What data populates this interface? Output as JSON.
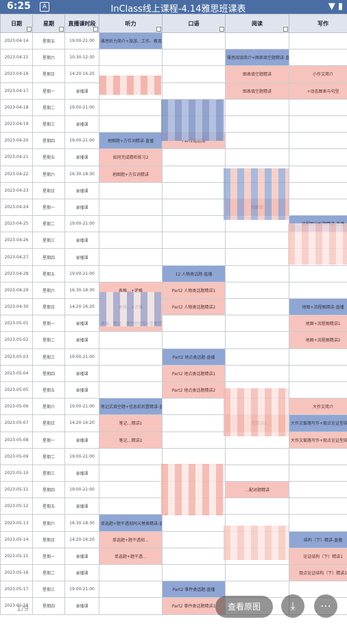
{
  "status_bar": {
    "time": "6:25",
    "app_badge": "A",
    "title": "InClass线上课程-4.14雅思班课表",
    "icons": "▼ ▮"
  },
  "headers": {
    "date": "日期",
    "weekday": "星期",
    "time": "直播课时段",
    "listening": "听力",
    "speaking": "口语",
    "reading": "阅读",
    "writing": "写作"
  },
  "rows": [
    {
      "date": "2023-04-14",
      "week": "星期五",
      "time": "19:00-21:00",
      "l": "雅思听力简介+旅游、工作、教育相关场景词-直播",
      "s": "",
      "r": "",
      "w": ""
    },
    {
      "date": "2023-04-15",
      "week": "星期六",
      "time": "10:30-12:30",
      "l": "",
      "s": "",
      "r": "雅思阅读简介+图表填空题精讲-直播",
      "w": ""
    },
    {
      "date": "2023-04-16",
      "week": "星期日",
      "time": "14:20-16:20",
      "l": "",
      "s": "",
      "r": "图表填空题精讲",
      "w": "小作文简介"
    },
    {
      "date": "2023-04-17",
      "week": "星期一",
      "time": "录播课",
      "l": "",
      "s": "",
      "r": "图表填空题精讲",
      "w": "+动态图表与句型"
    },
    {
      "date": "2023-04-18",
      "week": "星期二",
      "time": "19:00-21:00",
      "l": "",
      "s": "",
      "r": "",
      "w": ""
    },
    {
      "date": "2023-04-19",
      "week": "星期三",
      "time": "录播课",
      "l": "",
      "s": "",
      "r": "",
      "w": ""
    },
    {
      "date": "2023-04-20",
      "week": "星期四",
      "time": "19:00-21:00",
      "l": "地图题+方位词精讲-直播",
      "s": "Part1话题精",
      "r": "",
      "w": ""
    },
    {
      "date": "2023-04-21",
      "week": "星期五",
      "time": "录播课",
      "l": "如何完成精听练习2",
      "s": "",
      "r": "",
      "w": ""
    },
    {
      "date": "2023-04-22",
      "week": "星期六",
      "time": "16:30-18:30",
      "l": "地图题+方位词精讲",
      "s": "",
      "r": "",
      "w": ""
    },
    {
      "date": "2023-04-23",
      "week": "星期日",
      "time": "录播课",
      "l": "",
      "s": "",
      "r": "",
      "w": ""
    },
    {
      "date": "2023-04-24",
      "week": "星期一",
      "time": "录播课",
      "l": "",
      "s": "",
      "r": "判断题",
      "w": ""
    },
    {
      "date": "2023-04-25",
      "week": "星期二",
      "time": "19:00-21:00",
      "l": "",
      "s": "",
      "r": "",
      "w": "流程图分析题精讲-直播"
    },
    {
      "date": "2023-04-26",
      "week": "星期三",
      "time": "录播课",
      "l": "",
      "s": "",
      "r": "",
      "w": ""
    },
    {
      "date": "2023-04-27",
      "week": "星期四",
      "time": "录播课",
      "l": "",
      "s": "",
      "r": "",
      "w": ""
    },
    {
      "date": "2023-04-28",
      "week": "星期五",
      "time": "19:00-21:00",
      "l": "",
      "s": "12 人物类话题-直播",
      "r": "",
      "w": ""
    },
    {
      "date": "2023-04-29",
      "week": "星期六",
      "time": "16:30-18:30",
      "l": "表格…+逆推",
      "s": "Part2 人物类话题精讲1",
      "r": "",
      "w": ""
    },
    {
      "date": "2023-04-30",
      "week": "星期日",
      "time": "14:20-16:20",
      "l": "表格…+逆推",
      "s": "Part2 人物类话题精讲2",
      "r": "",
      "w": "地图+流程图精讲-直播"
    },
    {
      "date": "2023-05-01",
      "week": "星期一",
      "time": "录播课",
      "l": "表格、笔记、填空题定位+逆推信号词精讲2",
      "s": "",
      "r": "",
      "w": "地图+流程图精讲1"
    },
    {
      "date": "2023-05-02",
      "week": "星期二",
      "time": "录播课",
      "l": "",
      "s": "",
      "r": "",
      "w": "地图+流程图精讲2"
    },
    {
      "date": "2023-05-03",
      "week": "星期三",
      "time": "19:00-21:00",
      "l": "",
      "s": "Part2 地点类话题-直播",
      "r": "",
      "w": ""
    },
    {
      "date": "2023-05-04",
      "week": "星期四",
      "time": "录播课",
      "l": "",
      "s": "Part2 地点类话题精讲1",
      "r": "",
      "w": ""
    },
    {
      "date": "2023-05-05",
      "week": "星期五",
      "time": "录播课",
      "l": "",
      "s": "Part2 地点类话题精讲2",
      "r": "",
      "w": ""
    },
    {
      "date": "2023-05-06",
      "week": "星期六",
      "time": "19:00-21:00",
      "l": "笔记式填空题+信息前后置精讲-直播",
      "s": "",
      "r": "",
      "w": "大作文简介"
    },
    {
      "date": "2023-05-07",
      "week": "星期日",
      "time": "14:20-16:20",
      "l": "笔记…精讲1",
      "s": "",
      "r": "…题精讲2",
      "w": "大作文套路写作+观点论证型结构（上）精讲-直播"
    },
    {
      "date": "2023-05-08",
      "week": "星期一",
      "time": "录播课",
      "l": "笔记…精讲2",
      "s": "",
      "r": "",
      "w": "大作文套路写作+观点论证型结构（上）"
    },
    {
      "date": "2023-05-09",
      "week": "星期二",
      "time": "19:00-21:00",
      "l": "",
      "s": "",
      "r": "",
      "w": ""
    },
    {
      "date": "2023-05-10",
      "week": "星期三",
      "time": "录播课",
      "l": "",
      "s": "",
      "r": "",
      "w": ""
    },
    {
      "date": "2023-05-11",
      "week": "星期四",
      "time": "19:00-21:00",
      "l": "",
      "s": "",
      "r": "…配对题精讲",
      "w": ""
    },
    {
      "date": "2023-05-12",
      "week": "星期五",
      "time": "录播课",
      "l": "",
      "s": "",
      "r": "",
      "w": ""
    },
    {
      "date": "2023-05-13",
      "week": "星期六",
      "time": "16:30-18:30",
      "l": "单选题+题干透彻同义替换精讲-直播",
      "s": "",
      "r": "",
      "w": ""
    },
    {
      "date": "2023-05-14",
      "week": "星期日",
      "time": "14:20-16:20",
      "l": "单选题+题干透彻…",
      "s": "",
      "r": "",
      "w": "结构（下）精讲-直播"
    },
    {
      "date": "2023-05-15",
      "week": "星期一",
      "time": "录播课",
      "l": "单选题+题干透…",
      "s": "",
      "r": "",
      "w": "论证结构（下）精讲1"
    },
    {
      "date": "2023-05-16",
      "week": "星期二",
      "time": "录播课",
      "l": "",
      "s": "",
      "r": "",
      "w": "观点论证结构（下）精讲2"
    },
    {
      "date": "2023-05-17",
      "week": "星期三",
      "time": "19:00-21:00",
      "l": "",
      "s": "Part2 事件类话题-直播",
      "r": "",
      "w": ""
    },
    {
      "date": "2023-05-18",
      "week": "星期四",
      "time": "录播课",
      "l": "",
      "s": "Part2 事件类话题精讲1",
      "r": "",
      "w": ""
    }
  ],
  "bottom": {
    "view_original": "查看原图",
    "page_indicator": "1/9",
    "download_icon": "⤓",
    "more_icon": "⋯"
  },
  "colors": {
    "status_bar": "#4a6ea3",
    "header": "#dfe4ee",
    "live_blue": "#8fa6d4",
    "record_pink": "#f6c4bd"
  }
}
